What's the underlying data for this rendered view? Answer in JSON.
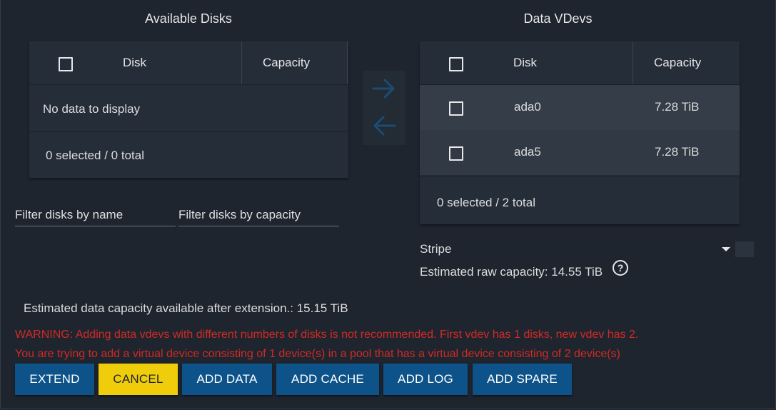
{
  "available": {
    "title": "Available Disks",
    "col_disk": "Disk",
    "col_capacity": "Capacity",
    "empty_message": "No data to display",
    "footer": "0 selected / 0 total"
  },
  "vdevs": {
    "title": "Data VDevs",
    "col_disk": "Disk",
    "col_capacity": "Capacity",
    "rows": [
      {
        "disk": "ada0",
        "capacity": "7.28 TiB"
      },
      {
        "disk": "ada5",
        "capacity": "7.28 TiB"
      }
    ],
    "footer": "0 selected / 2 total"
  },
  "filters": {
    "name": "Filter disks by name",
    "capacity": "Filter disks by capacity"
  },
  "layout_select": {
    "value": "Stripe",
    "icon": "caret-down-icon"
  },
  "raw_capacity": "Estimated raw capacity: 14.55 TiB",
  "help_icon": "?",
  "data_capacity": "Estimated data capacity available after extension.: 15.15 TiB",
  "warnings": [
    "WARNING: Adding data vdevs with different numbers of disks is not recommended. First vdev has 1 disks, new vdev has 2.",
    "You are trying to add a virtual device consisting of 1 device(s) in a pool that has a virtual device consisting of 2 device(s)"
  ],
  "buttons": {
    "extend": "EXTEND",
    "cancel": "CANCEL",
    "add_data": "ADD DATA",
    "add_cache": "ADD CACHE",
    "add_log": "ADD LOG",
    "add_spare": "ADD SPARE"
  },
  "colors": {
    "background": "#1e252f",
    "panel": "#252d38",
    "primary_button": "#0d5288",
    "cancel_button": "#f0cd0a",
    "warning_text": "#d22a24",
    "arrow": "#1b4d73"
  }
}
